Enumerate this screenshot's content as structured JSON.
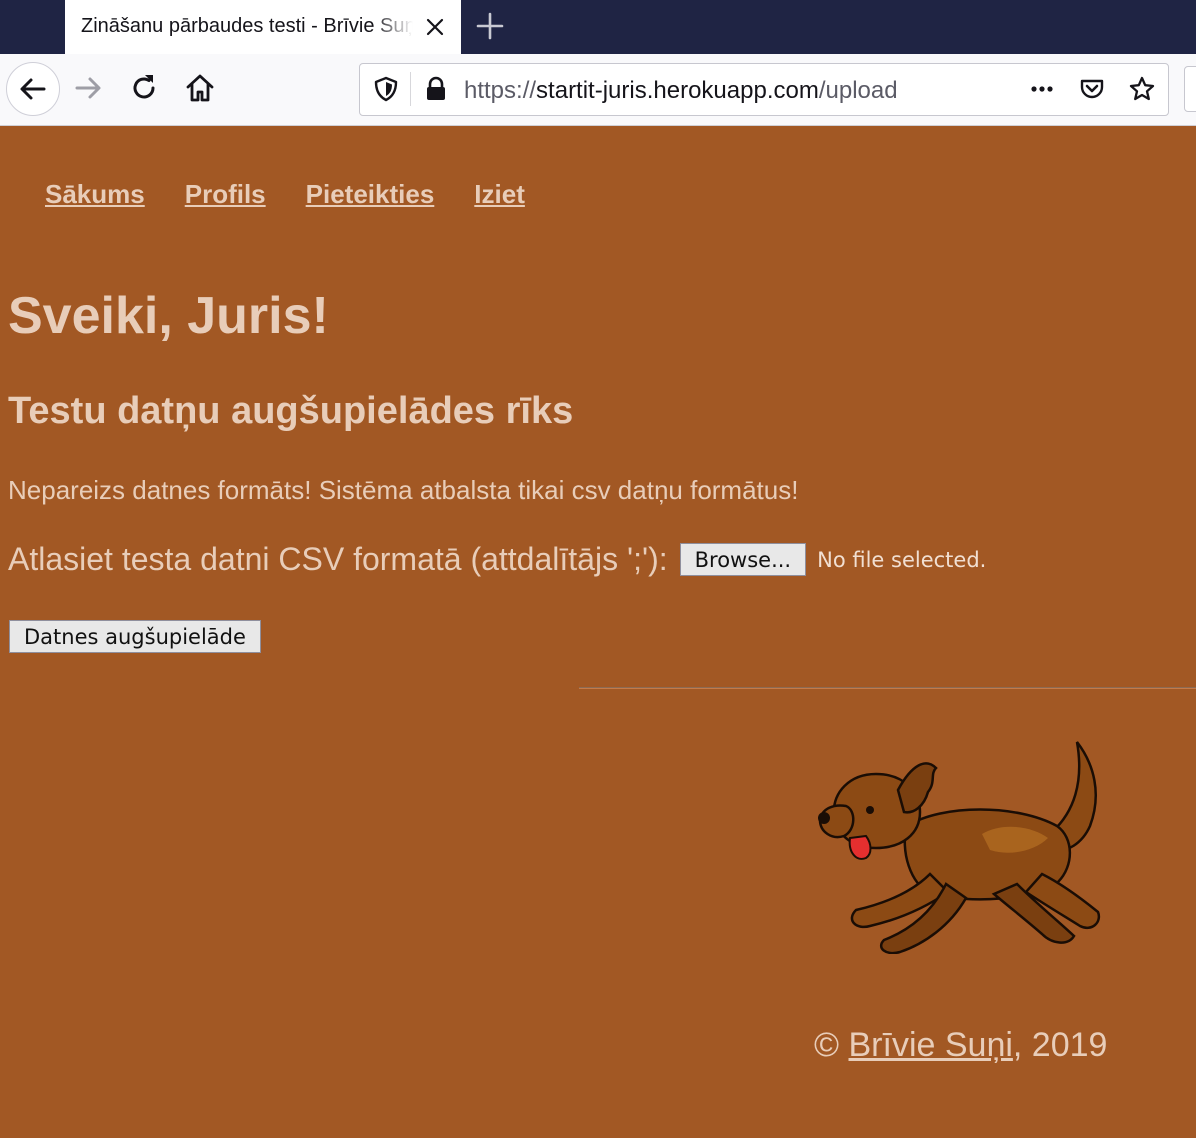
{
  "browser": {
    "tab_title": "Zināšanu pārbaudes testi - Brīvie Suņi",
    "url_scheme": "https://",
    "url_host": "startit-juris.herokuapp.com",
    "url_path": "/upload"
  },
  "nav": {
    "items": [
      {
        "label": "Sākums"
      },
      {
        "label": "Profils"
      },
      {
        "label": "Pieteikties"
      },
      {
        "label": "Iziet"
      }
    ]
  },
  "main": {
    "greeting": "Sveiki, Juris!",
    "tool_title": "Testu datņu augšupielādes rīks",
    "error_message": "Nepareizs datnes formāts! Sistēma atbalsta tikai csv datņu formātus!",
    "file_label": "Atlasiet testa datni CSV formatā (attdalītājs ';'):",
    "browse_label": "Browse...",
    "no_file_text": "No file selected.",
    "upload_label": "Datnes augšupielāde"
  },
  "footer": {
    "copyright": "© ",
    "link": "Brīvie Suņi",
    "year": ", 2019"
  },
  "colors": {
    "page_background": "#a25824",
    "text": "#e8cdb9",
    "tab_strip": "#1f2444"
  }
}
